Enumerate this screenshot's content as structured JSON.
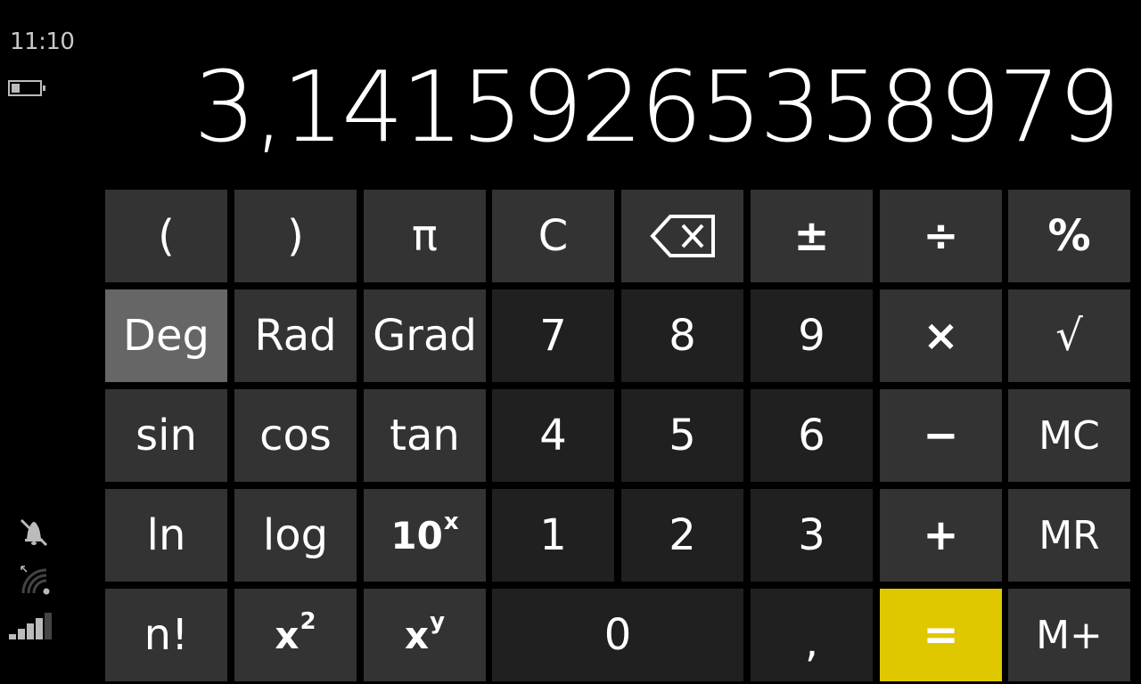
{
  "status_bar": {
    "time": "11:10",
    "battery_level_fraction": 0.3,
    "icons": [
      "battery-icon",
      "quiet-hours-bell-icon",
      "wifi-icon",
      "signal-strength-icon"
    ],
    "signal_bars_active": 4,
    "signal_bars_total": 5
  },
  "display": {
    "value": "3,14159265358979"
  },
  "keys": {
    "open_paren": "(",
    "close_paren": ")",
    "pi": "π",
    "clear": "C",
    "backspace": "backspace",
    "plus_minus": "±",
    "divide": "÷",
    "percent": "%",
    "deg": "Deg",
    "rad": "Rad",
    "grad": "Grad",
    "seven": "7",
    "eight": "8",
    "nine": "9",
    "multiply": "×",
    "sqrt": "√",
    "sin": "sin",
    "cos": "cos",
    "tan": "tan",
    "four": "4",
    "five": "5",
    "six": "6",
    "minus": "−",
    "mc": "MC",
    "ln": "ln",
    "log": "log",
    "ten_base": "10",
    "ten_exp": "x",
    "one": "1",
    "two": "2",
    "three": "3",
    "plus": "+",
    "mr": "MR",
    "factorial": "n!",
    "square_base": "x",
    "square_exp": "2",
    "power_base": "x",
    "power_exp": "y",
    "zero": "0",
    "decimal": ",",
    "equals": "=",
    "mplus": "M+"
  },
  "angle_mode": "Deg",
  "colors": {
    "accent": "#e0c800",
    "function_key": "#333333",
    "number_key": "#202020",
    "active_mode_key": "#666666"
  }
}
